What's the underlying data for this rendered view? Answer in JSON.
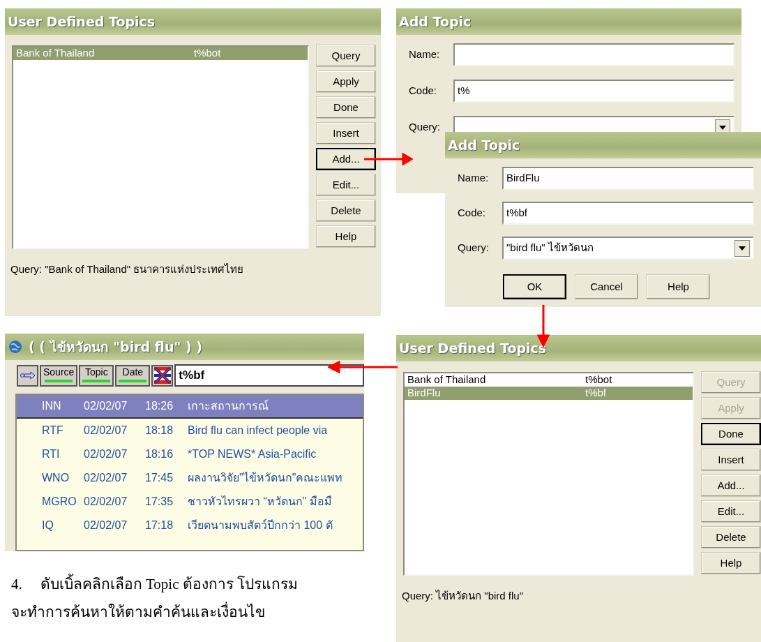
{
  "topics_dialog_before": {
    "title": "User Defined Topics",
    "items": [
      {
        "name": "Bank of Thailand",
        "code": "t%bot",
        "selected": true
      }
    ],
    "buttons": [
      {
        "label": "Query",
        "disabled": false,
        "default": false
      },
      {
        "label": "Apply",
        "disabled": false,
        "default": false
      },
      {
        "label": "Done",
        "disabled": false,
        "default": false
      },
      {
        "label": "Insert",
        "disabled": false,
        "default": false
      },
      {
        "label": "Add...",
        "disabled": false,
        "default": true
      },
      {
        "label": "Edit...",
        "disabled": false,
        "default": false
      },
      {
        "label": "Delete",
        "disabled": false,
        "default": false
      },
      {
        "label": "Help",
        "disabled": false,
        "default": false
      }
    ],
    "query": "Query:  \"Bank of Thailand\" ธนาคารแห่งประเทศไทย"
  },
  "add_topic_empty": {
    "title": "Add Topic",
    "fields": [
      {
        "label": "Name:",
        "kind": "text"
      },
      {
        "label": "Code:",
        "value": "t%",
        "kind": "text"
      },
      {
        "label": "Query:",
        "kind": "combo"
      }
    ]
  },
  "add_topic_filled": {
    "title": "Add Topic",
    "fields": [
      {
        "label": "Name:",
        "value": "BirdFlu",
        "kind": "text"
      },
      {
        "label": "Code:",
        "value": "t%bf",
        "kind": "text"
      },
      {
        "label": "Query:",
        "value": "\"bird flu\" ไข้หวัดนก",
        "kind": "combo"
      }
    ],
    "buttons": [
      {
        "label": "OK",
        "disabled": false,
        "default": true
      },
      {
        "label": "Cancel",
        "disabled": false,
        "default": false
      },
      {
        "label": "Help",
        "disabled": false,
        "default": false
      }
    ]
  },
  "news_window": {
    "title": "( ( ไข้หวัดนก \"bird flu\" ) )",
    "filters": [
      "Source",
      "Topic",
      "Date"
    ],
    "code": "t%bf",
    "rows": [
      {
        "source": "INN",
        "date": "02/02/07",
        "time": "18:26",
        "headline": "เกาะสถานการณ์",
        "selected": true
      },
      {
        "source": "RTF",
        "date": "02/02/07",
        "time": "18:18",
        "headline": "Bird flu can infect people via",
        "selected": false
      },
      {
        "source": "RTI",
        "date": "02/02/07",
        "time": "18:16",
        "headline": "*TOP NEWS* Asia-Pacific",
        "selected": false
      },
      {
        "source": "WNO",
        "date": "02/02/07",
        "time": "17:45",
        "headline": "ผลงานวิจัย\"ไข้หวัดนก\"คณะแพท",
        "selected": false
      },
      {
        "source": "MGRO",
        "date": "02/02/07",
        "time": "17:35",
        "headline": "ชาวหัวไทรผวา “หวัดนก” มือมื",
        "selected": false
      },
      {
        "source": "IQ",
        "date": "02/02/07",
        "time": "17:18",
        "headline": "เวียดนามพบสัตว์ปีกกว่า 100 ตั",
        "selected": false
      }
    ]
  },
  "topics_dialog_after": {
    "title": "User Defined Topics",
    "items": [
      {
        "name": "Bank of Thailand",
        "code": "t%bot",
        "selected": false
      },
      {
        "name": "BirdFlu",
        "code": "t%bf",
        "selected": true
      }
    ],
    "buttons": [
      {
        "label": "Query",
        "disabled": true,
        "default": false
      },
      {
        "label": "Apply",
        "disabled": true,
        "default": false
      },
      {
        "label": "Done",
        "disabled": false,
        "default": true
      },
      {
        "label": "Insert",
        "disabled": false,
        "default": false
      },
      {
        "label": "Add...",
        "disabled": false,
        "default": false
      },
      {
        "label": "Edit...",
        "disabled": false,
        "default": false
      },
      {
        "label": "Delete",
        "disabled": false,
        "default": false
      },
      {
        "label": "Help",
        "disabled": false,
        "default": false
      }
    ],
    "query": "Query: ไข้หวัดนก \"bird flu\""
  },
  "instruction": {
    "number": "4.",
    "lines": [
      "ดับเบิ้ลคลิกเลือก Topic ต้องการ โปรแกรม",
      "จะทำการค้นหาให้ตามคำค้นและเงื่อนไข"
    ]
  }
}
